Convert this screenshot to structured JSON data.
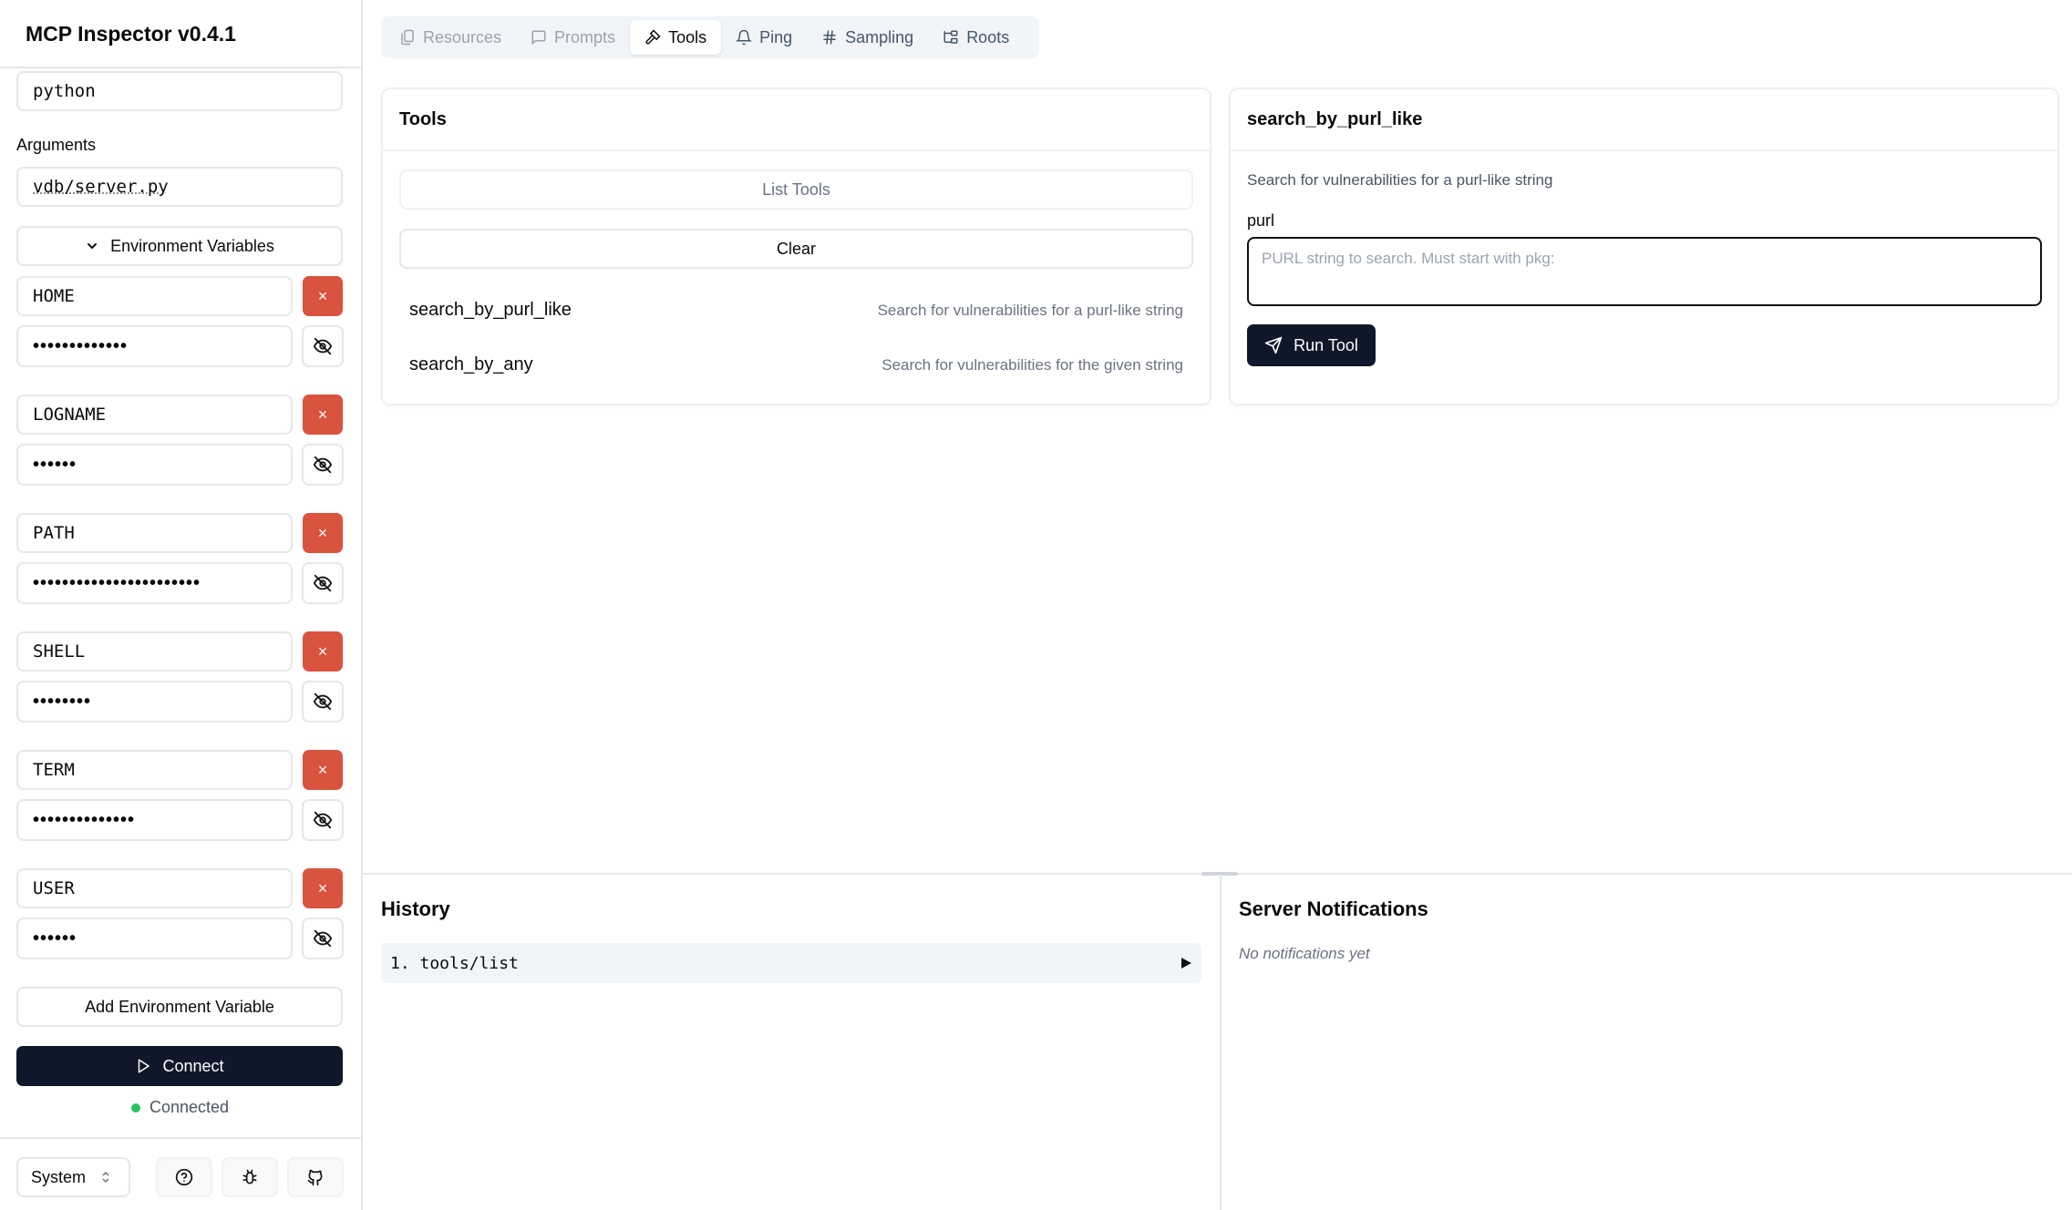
{
  "app": {
    "title": "MCP Inspector v0.4.1"
  },
  "sidebar": {
    "command_value": "python",
    "arguments_label": "Arguments",
    "arguments_value": "vdb/server.py",
    "env_toggle_label": "Environment Variables",
    "env_vars": [
      {
        "key": "HOME",
        "value_masked": "•••••••••••••"
      },
      {
        "key": "LOGNAME",
        "value_masked": "••••••"
      },
      {
        "key": "PATH",
        "value_masked": "•••••••••••••••••••••••"
      },
      {
        "key": "SHELL",
        "value_masked": "••••••••"
      },
      {
        "key": "TERM",
        "value_masked": "••••••••••••••"
      },
      {
        "key": "USER",
        "value_masked": "••••••"
      }
    ],
    "delete_glyph": "×",
    "add_env_label": "Add Environment Variable",
    "connect_label": "Connect",
    "status_text": "Connected",
    "theme_select": "System"
  },
  "tabs": [
    {
      "label": "Resources",
      "icon": "files-icon"
    },
    {
      "label": "Prompts",
      "icon": "message-icon"
    },
    {
      "label": "Tools",
      "icon": "hammer-icon"
    },
    {
      "label": "Ping",
      "icon": "bell-icon"
    },
    {
      "label": "Sampling",
      "icon": "hash-icon"
    },
    {
      "label": "Roots",
      "icon": "folder-tree-icon"
    }
  ],
  "tools_panel": {
    "title": "Tools",
    "list_tools_label": "List Tools",
    "clear_label": "Clear",
    "tools": [
      {
        "name": "search_by_purl_like",
        "description": "Search for vulnerabilities for a purl-like string"
      },
      {
        "name": "search_by_any",
        "description": "Search for vulnerabilities for the given string"
      }
    ]
  },
  "tool_detail": {
    "title": "search_by_purl_like",
    "description": "Search for vulnerabilities for a purl-like string",
    "param_label": "purl",
    "param_placeholder": "PURL string to search. Must start with pkg:",
    "run_label": "Run Tool"
  },
  "history": {
    "title": "History",
    "items": [
      {
        "label": "1. tools/list"
      }
    ]
  },
  "notifications": {
    "title": "Server Notifications",
    "empty_text": "No notifications yet"
  },
  "colors": {
    "danger": "#d9533f",
    "primary": "#0f172a",
    "success": "#22c55e"
  }
}
